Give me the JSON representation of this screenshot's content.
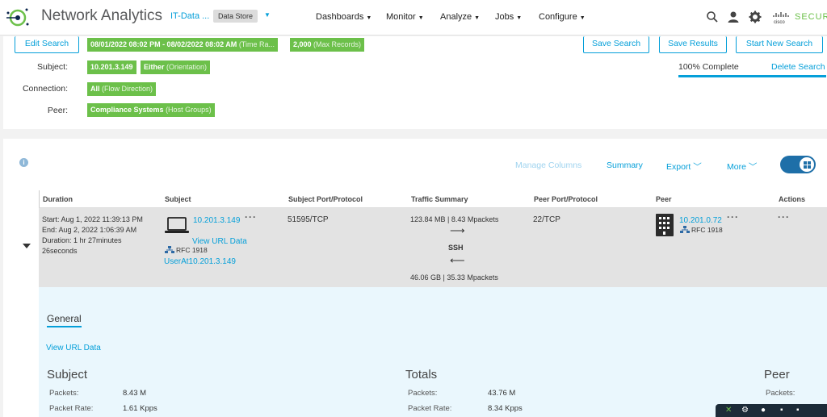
{
  "header": {
    "app_title": "Network Analytics",
    "tenant": "IT-Data ...",
    "datastore": "Data Store",
    "nav": [
      "Dashboards",
      "Monitor",
      "Analyze",
      "Jobs",
      "Configure"
    ],
    "brand": "SECUR"
  },
  "query": {
    "edit_search": "Edit Search",
    "time_range_value": "08/01/2022 08:02 PM - 08/02/2022 08:02 AM",
    "time_range_label": "(Time Ra...",
    "max_records_value": "2,000",
    "max_records_label": "(Max Records)",
    "subject_label": "Subject:",
    "subject_ip": "10.201.3.149",
    "orientation_value": "Either",
    "orientation_label": "(Orientation)",
    "connection_label": "Connection:",
    "flow_direction_value": "All",
    "flow_direction_label": "(Flow Direction)",
    "peer_label": "Peer:",
    "host_group_value": "Compliance Systems",
    "host_group_label": "(Host Groups)",
    "save_search": "Save Search",
    "save_results": "Save Results",
    "start_new_search": "Start New Search",
    "progress_text": "100% Complete",
    "progress_fraction": 1.0,
    "delete_search": "Delete Search"
  },
  "toolbar": {
    "manage_columns": "Manage Columns",
    "summary": "Summary",
    "export": "Export",
    "more": "More"
  },
  "table": {
    "headers": [
      "Duration",
      "Subject",
      "Subject Port/Protocol",
      "Traffic Summary",
      "Peer Port/Protocol",
      "Peer",
      "Actions"
    ],
    "row": {
      "start": "Start: Aug 1, 2022 11:39:13 PM",
      "end": "End: Aug 2, 2022 1:06:39 AM",
      "duration": "Duration: 1 hr 27minutes",
      "duration_seconds": "26seconds",
      "subject_ip": "10.201.3.149",
      "view_url_data": "View URL Data",
      "subject_rfc": "RFC 1918",
      "subject_user": "UserAt10.201.3.149",
      "subject_port": "51595/TCP",
      "traffic_out": "123.84 MB | 8.43 Mpackets",
      "app": "SSH",
      "traffic_in": "46.06 GB | 35.33 Mpackets",
      "peer_port": "22/TCP",
      "peer_ip": "10.201.0.72",
      "peer_rfc": "RFC 1918"
    }
  },
  "detail": {
    "tab": "General",
    "view_url_data": "View URL Data",
    "subject_title": "Subject",
    "totals_title": "Totals",
    "peer_title": "Peer",
    "packets_label": "Packets:",
    "packet_rate_label": "Packet Rate:",
    "subject_packets": "8.43 M",
    "subject_packet_rate": "1.61 Kpps",
    "totals_packets": "43.76 M",
    "totals_packet_rate": "8.34 Kpps",
    "peer_packets_label": "Packets:"
  },
  "colors": {
    "accent": "#049fd9",
    "chip_green": "#6cc04a",
    "toggle_blue": "#1e6fa8"
  }
}
